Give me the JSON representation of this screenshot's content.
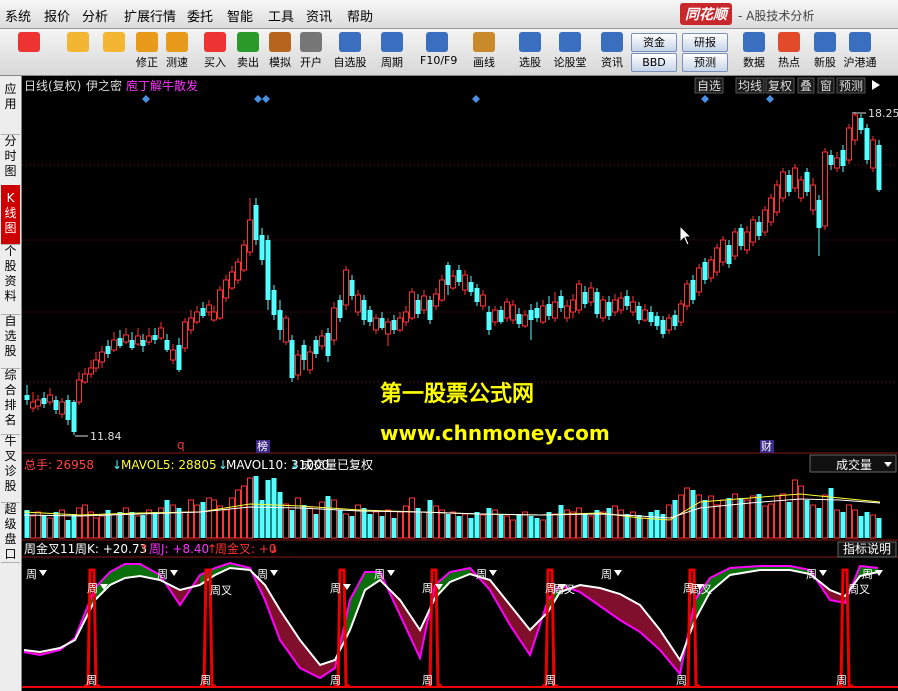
{
  "menu": [
    "系统",
    "报价",
    "分析",
    "扩展行情",
    "委托",
    "智能",
    "工具",
    "资讯",
    "帮助"
  ],
  "brand": {
    "logo": "同花顺",
    "title": "- A股技术分析"
  },
  "toolbar": [
    {
      "label": "",
      "icon": "windows-icon"
    },
    {
      "label": "",
      "icon": "back-arrow-icon"
    },
    {
      "label": "",
      "icon": "up-down-arrows-icon"
    },
    {
      "label": "修正",
      "icon": "correct-icon"
    },
    {
      "label": "测速",
      "icon": "clock-icon"
    },
    {
      "label": "买入",
      "icon": "buy-icon"
    },
    {
      "label": "卖出",
      "icon": "sell-icon"
    },
    {
      "label": "模拟",
      "icon": "hammer-icon"
    },
    {
      "label": "开户",
      "icon": "lock-icon"
    },
    {
      "label": "自选股",
      "icon": "star-icon"
    },
    {
      "label": "周期",
      "icon": "period-icon"
    },
    {
      "label": "F10/F9",
      "icon": "f10-icon"
    },
    {
      "label": "画线",
      "icon": "pencil-icon"
    },
    {
      "label": "选股",
      "icon": "select-stock-icon"
    },
    {
      "label": "论股堂",
      "icon": "discuss-icon"
    },
    {
      "label": "资讯",
      "icon": "news-icon"
    },
    {
      "label": "数据",
      "icon": "pe-icon"
    },
    {
      "label": "热点",
      "icon": "hot-icon"
    },
    {
      "label": "新股",
      "icon": "new-stock-icon"
    },
    {
      "label": "沪港通",
      "icon": "hk-connect-icon"
    }
  ],
  "toolbar_pills": [
    "资金",
    "研报",
    "BBD",
    "预测"
  ],
  "sidebar": [
    "应用",
    "分时图",
    "K线图",
    "个股资料",
    "自选股",
    "综合排名",
    "牛叉诊股",
    "超级盘口"
  ],
  "main_header": {
    "label1": "日线(复权)",
    "label2": "伊之密",
    "label3": "庖丁解牛散发",
    "buttons": [
      "自选",
      "均线",
      "复权",
      "叠",
      "窗",
      "预测"
    ],
    "high_label": "18.25",
    "low_label": "11.84"
  },
  "event_markers": [
    "q",
    "榜",
    "财"
  ],
  "watermark": {
    "line1": "第一股票公式网",
    "line2": "www.chnmoney.com"
  },
  "volume_header": {
    "total": "总手: 26958",
    "mavol5": "MAVOL5: 28805",
    "mavol10": "MAVOL10: 31000",
    "note": "成交量已复权",
    "select": "成交量"
  },
  "indicator_header": {
    "name": "周金叉11",
    "k": "周K: +20.73",
    "j": "周J: +8.40",
    "gold": "周金叉: +0",
    "button": "指标说明"
  },
  "indicator_labels": {
    "week": "周",
    "cross": "周叉"
  },
  "colors": {
    "up": "#ff3333",
    "down": "#54ffff",
    "gold_line": "#ffff00",
    "white_line": "#ffffff",
    "magenta": "#ff00ff",
    "green_fill": "#0a6f0a",
    "maroon_fill": "#7f0f2a",
    "pulse": "#ee0000"
  }
}
